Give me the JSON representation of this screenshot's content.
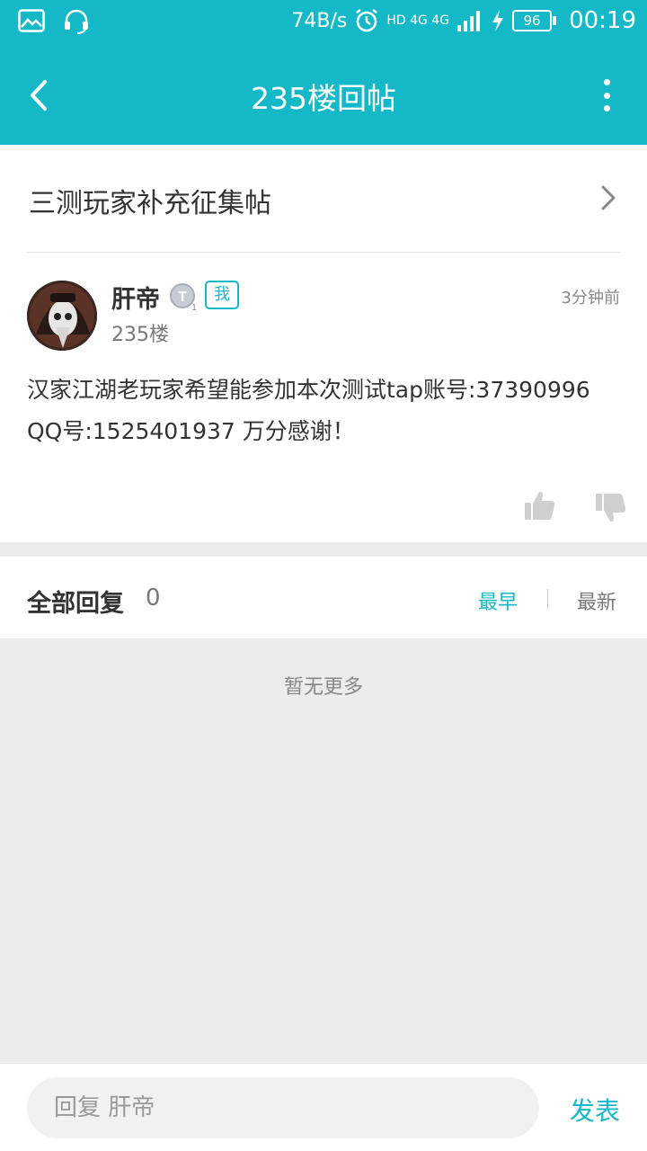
{
  "status_bar": {
    "net_speed": "74B/s",
    "network_label": "HD 4G 4G",
    "battery": "96",
    "time": "00:19"
  },
  "header": {
    "title": "235楼回帖"
  },
  "thread": {
    "title": "三测玩家补充征集帖"
  },
  "post": {
    "username": "肝帝",
    "level_badge": "T",
    "level_num": "1",
    "me_tag": "我",
    "floor": "235楼",
    "time": "3分钟前",
    "content": "汉家江湖老玩家希望能参加本次测试tap账号:37390996 QQ号:1525401937 万分感谢！"
  },
  "replies": {
    "title": "全部回复",
    "count": "0",
    "sort_earliest": "最早",
    "sort_newest": "最新",
    "empty_text": "暂无更多"
  },
  "reply_bar": {
    "placeholder": "回复 肝帝",
    "send_label": "发表"
  },
  "colors": {
    "accent": "#14b8c7",
    "background": "#ececec"
  }
}
